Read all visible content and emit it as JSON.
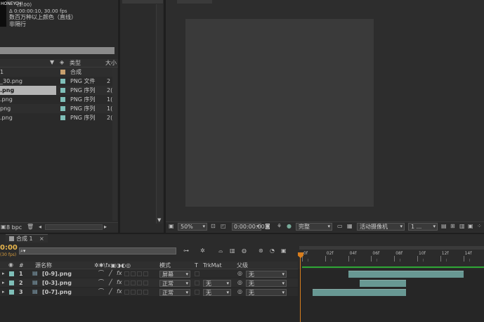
{
  "info": {
    "line1": "(1.00)",
    "line2": "Δ 0:00:00:10, 30.00 fps",
    "line3": "数百万种以上颜色（直线）",
    "line4": "非隔行",
    "logo": "HONEYCHI"
  },
  "project": {
    "header": {
      "name": "",
      "type": "类型",
      "size": "大小"
    },
    "items": [
      {
        "name": "1",
        "type": "合成",
        "size": "",
        "color": "#c8a06e",
        "selected": false
      },
      {
        "name": "_30.png",
        "type": "PNG 文件",
        "size": "2",
        "color": "#7fbfb8",
        "selected": false
      },
      {
        "name": ".png",
        "type": "PNG 序列",
        "size": "2(",
        "color": "#7fbfb8",
        "selected": true
      },
      {
        "name": ".png",
        "type": "PNG 序列",
        "size": "1(",
        "color": "#7fbfb8",
        "selected": false
      },
      {
        "name": "png",
        "type": "PNG 序列",
        "size": "1(",
        "color": "#7fbfb8",
        "selected": false
      },
      {
        "name": ".png",
        "type": "PNG 序列",
        "size": "2(",
        "color": "#7fbfb8",
        "selected": false
      }
    ],
    "bpc": "8 bpc"
  },
  "comp_tab": "合成",
  "viewer": {
    "zoom": "50%",
    "timecode": "0:00:00:00",
    "quality": "完整",
    "camera": "活动摄像机",
    "views": "1 ..."
  },
  "timeline": {
    "tab": "合成 1",
    "time": "0:00",
    "fps": "(30 fps)",
    "search_placeholder": "",
    "col_num": "#",
    "col_name": "源名称",
    "col_mode": "模式",
    "col_t": "T",
    "col_trkmat": "TrkMat",
    "col_parent": "父级",
    "ruler": [
      "0f",
      "02f",
      "04f",
      "06f",
      "08f",
      "10f",
      "12f",
      "14f"
    ],
    "layers": [
      {
        "num": "1",
        "name": "[0-9].png",
        "mode": "屏幕",
        "trkmat": "",
        "parent": "无",
        "bar_start": 4,
        "bar_end": 14
      },
      {
        "num": "2",
        "name": "[0-3].png",
        "mode": "正常",
        "trkmat": "无",
        "parent": "无",
        "bar_start": 5,
        "bar_end": 9
      },
      {
        "num": "3",
        "name": "[0-7].png",
        "mode": "正常",
        "trkmat": "无",
        "parent": "无",
        "bar_start": 1,
        "bar_end": 9
      }
    ],
    "colors": {
      "layer": "#7fbfb8",
      "work_area": "#2fa836",
      "playhead": "#d87e1e"
    }
  }
}
